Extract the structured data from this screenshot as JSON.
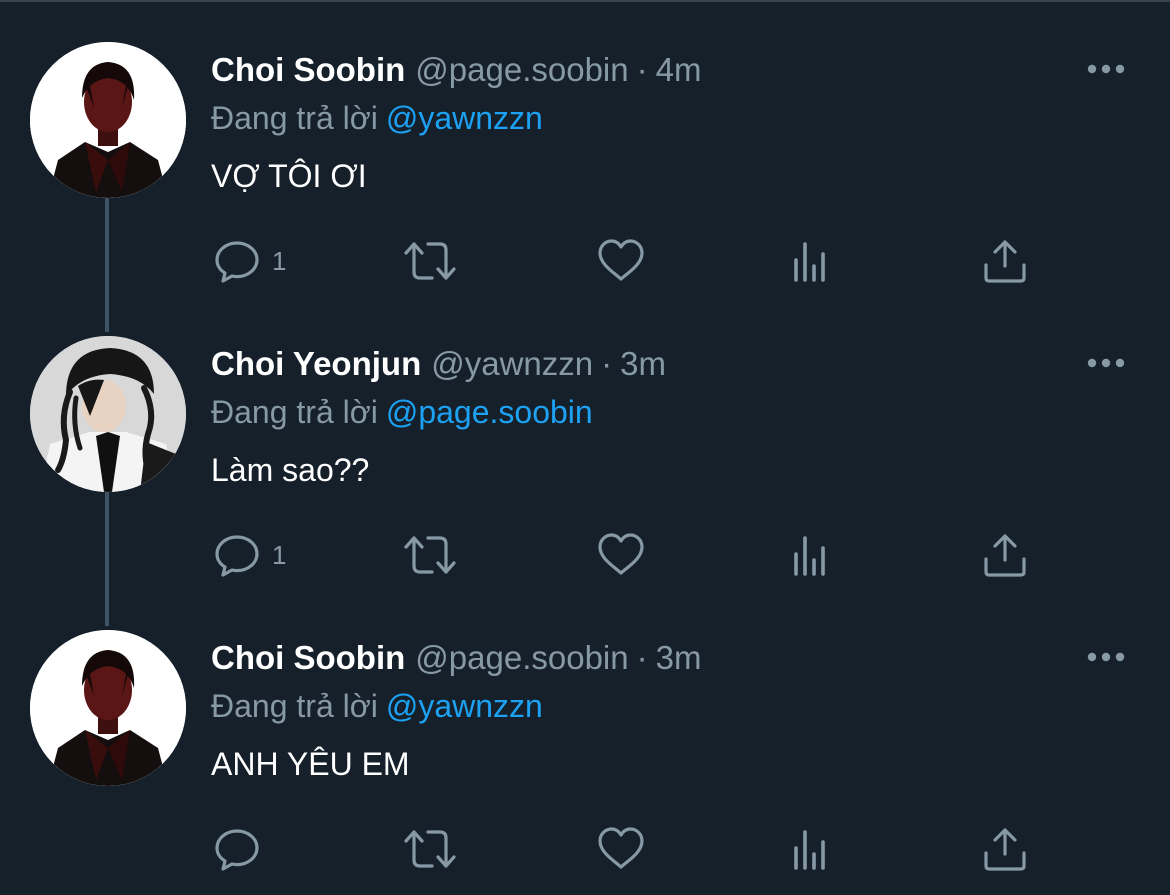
{
  "thread": {
    "tweets": [
      {
        "display_name": "Choi Soobin",
        "handle": "@page.soobin",
        "separator": "·",
        "time": "4m",
        "replying_label": "Đang trả lời",
        "replying_to": "@yawnzzn",
        "text": "VỢ TÔI ƠI",
        "reply_count": "1",
        "avatar": "soobin-avatar"
      },
      {
        "display_name": "Choi Yeonjun",
        "handle": "@yawnzzn",
        "separator": "·",
        "time": "3m",
        "replying_label": "Đang trả lời",
        "replying_to": "@page.soobin",
        "text": "Làm sao??",
        "reply_count": "1",
        "avatar": "yeonjun-avatar"
      },
      {
        "display_name": "Choi Soobin",
        "handle": "@page.soobin",
        "separator": "·",
        "time": "3m",
        "replying_label": "Đang trả lời",
        "replying_to": "@yawnzzn",
        "text": "ANH YÊU EM",
        "reply_count": "",
        "avatar": "soobin-avatar"
      }
    ]
  },
  "icons": {
    "reply": "reply-icon",
    "retweet": "retweet-icon",
    "like": "heart-icon",
    "analytics": "analytics-icon",
    "share": "share-icon",
    "more": "more-icon"
  },
  "colors": {
    "background": "#15202b",
    "secondary_text": "#8899a6",
    "link": "#1da1f2",
    "icon": "#8899a6",
    "thread_line": "#3d5466"
  }
}
